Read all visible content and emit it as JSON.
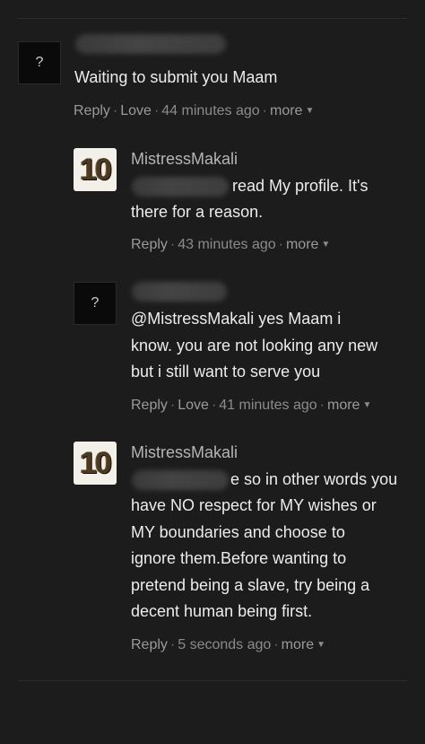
{
  "comments": [
    {
      "avatar": "?",
      "text": "Waiting to submit you Maam",
      "actions": {
        "reply": "Reply",
        "love": "Love",
        "time": "44 minutes ago",
        "more": "more"
      }
    },
    {
      "author": "MistressMakali",
      "avatar": "10",
      "text_after_blur": "read My profile. It's",
      "text_line2": "there for a reason.",
      "actions": {
        "reply": "Reply",
        "time": "43 minutes ago",
        "more": "more"
      }
    },
    {
      "avatar": "?",
      "text": "@MistressMakali yes Maam i\nknow. you are not looking any new\nbut i still want to serve you",
      "actions": {
        "reply": "Reply",
        "love": "Love",
        "time": "41 minutes ago",
        "more": "more"
      }
    },
    {
      "author": "MistressMakali",
      "avatar": "10",
      "text_after_blur": "e so in other words you",
      "text_rest": "have NO respect for MY wishes or\nMY boundaries and choose to\nignore them.Before wanting to\npretend being a slave, try being a\ndecent human being first.",
      "actions": {
        "reply": "Reply",
        "time": "5 seconds ago",
        "more": "more"
      }
    }
  ],
  "separator": "·",
  "icons": {
    "more_caret": "caret-down-icon",
    "unknown_avatar": "question-mark-icon"
  }
}
